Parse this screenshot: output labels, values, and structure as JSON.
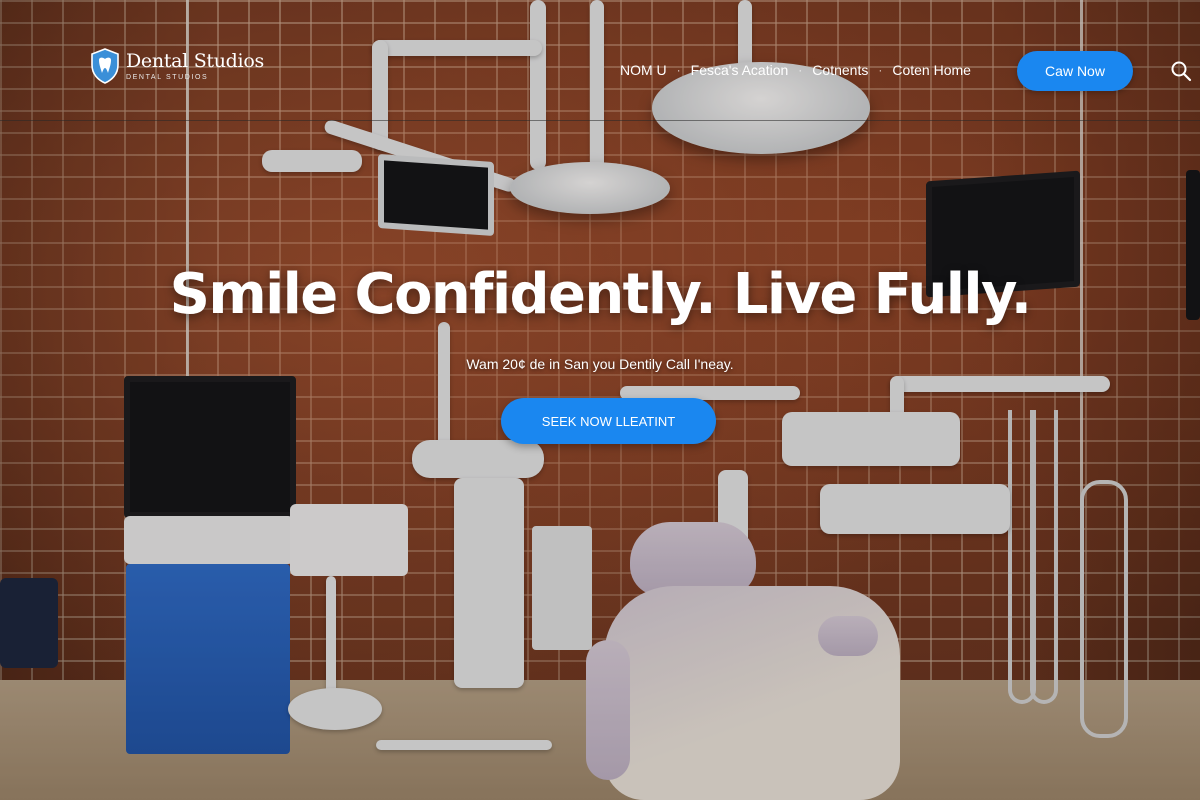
{
  "brand": {
    "name": "Dental Studios",
    "tagline": "DENTAL STUDIOS",
    "logo_icon": "tooth-shield-icon"
  },
  "nav": {
    "items": [
      {
        "label": "NOM U"
      },
      {
        "label": "Fesca's Acation"
      },
      {
        "label": "Cotnents"
      },
      {
        "label": "Coten Home"
      }
    ],
    "cta_label": "Caw Now",
    "search_icon": "search-icon"
  },
  "hero": {
    "title": "Smile Confidently. Live Fully.",
    "subtitle": "Wam 20¢ de in San you Dentily Call I'neay.",
    "button_label": "SEEK NOW LLEATINT"
  },
  "colors": {
    "accent": "#1a87f0",
    "text": "#ffffff",
    "brick": "#8a4328"
  }
}
